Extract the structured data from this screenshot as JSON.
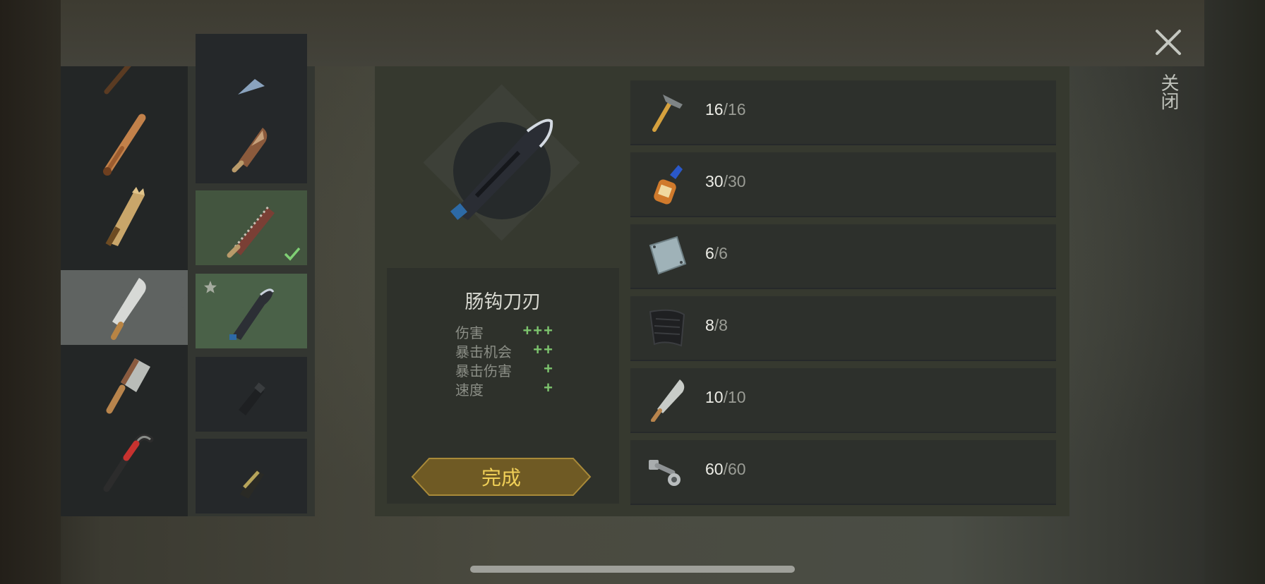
{
  "item": {
    "name": "肠钩刀刃",
    "stats": [
      {
        "label": "伤害",
        "value": "+++"
      },
      {
        "label": "暴击机会",
        "value": "++"
      },
      {
        "label": "暴击伤害",
        "value": "+"
      },
      {
        "label": "速度",
        "value": "+"
      }
    ],
    "complete_label": "完成"
  },
  "requirements": [
    {
      "icon": "hammer-icon",
      "have": "16",
      "need": "/16"
    },
    {
      "icon": "glue-bottle-icon",
      "have": "30",
      "need": "/30"
    },
    {
      "icon": "metal-plate-icon",
      "have": "6",
      "need": "/6"
    },
    {
      "icon": "rubber-sheet-icon",
      "have": "8",
      "need": "/8"
    },
    {
      "icon": "machete-blade-icon",
      "have": "10",
      "need": "/10"
    },
    {
      "icon": "bolts-icon",
      "have": "60",
      "need": "/60"
    }
  ],
  "close_label": "关闭",
  "weapon_list": [
    "pickaxe-icon",
    "baseball-bat-icon",
    "plank-icon",
    "machete-icon",
    "cleaver-icon",
    "crowbar-icon"
  ],
  "variant_list": [
    "blade-variant-icon",
    "rusty-blade-icon",
    "saw-blade-icon",
    "hook-blade-icon",
    "black-handle-icon",
    "wrapped-handle-icon"
  ],
  "colors": {
    "accent": "#f0cf57",
    "stat_plus": "#7cc36d",
    "selected_green": "#4a6148"
  }
}
